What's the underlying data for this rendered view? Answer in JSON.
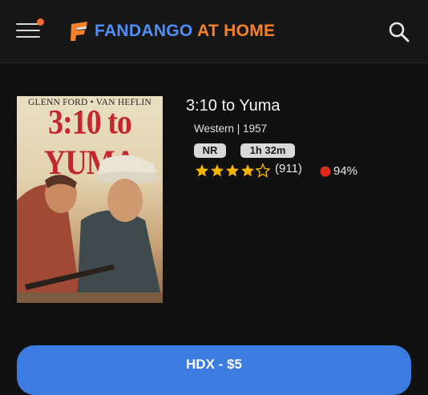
{
  "header": {
    "logo_word1": "FANDANGO",
    "logo_word2": "AT HOME",
    "icons": [
      "menu-icon",
      "fandango-logo-icon",
      "search-icon"
    ],
    "accent_colors": {
      "blue": "#4f8ef7",
      "orange": "#f5822a",
      "notification": "#f26a2e"
    }
  },
  "movie": {
    "poster": {
      "cast_line": "GLENN FORD • VAN HEFLIN",
      "title_art": "3:10 to YUMA"
    },
    "title": "3:10 to Yuma",
    "genre_year": "Western | 1957",
    "mpaa_rating": "NR",
    "runtime": "1h 32m",
    "star_rating": 4,
    "star_max": 5,
    "rating_count": "(911)",
    "tomatometer": "94%"
  },
  "purchase": {
    "button_label": "HDX - $5",
    "button_color": "#3c7be0"
  }
}
